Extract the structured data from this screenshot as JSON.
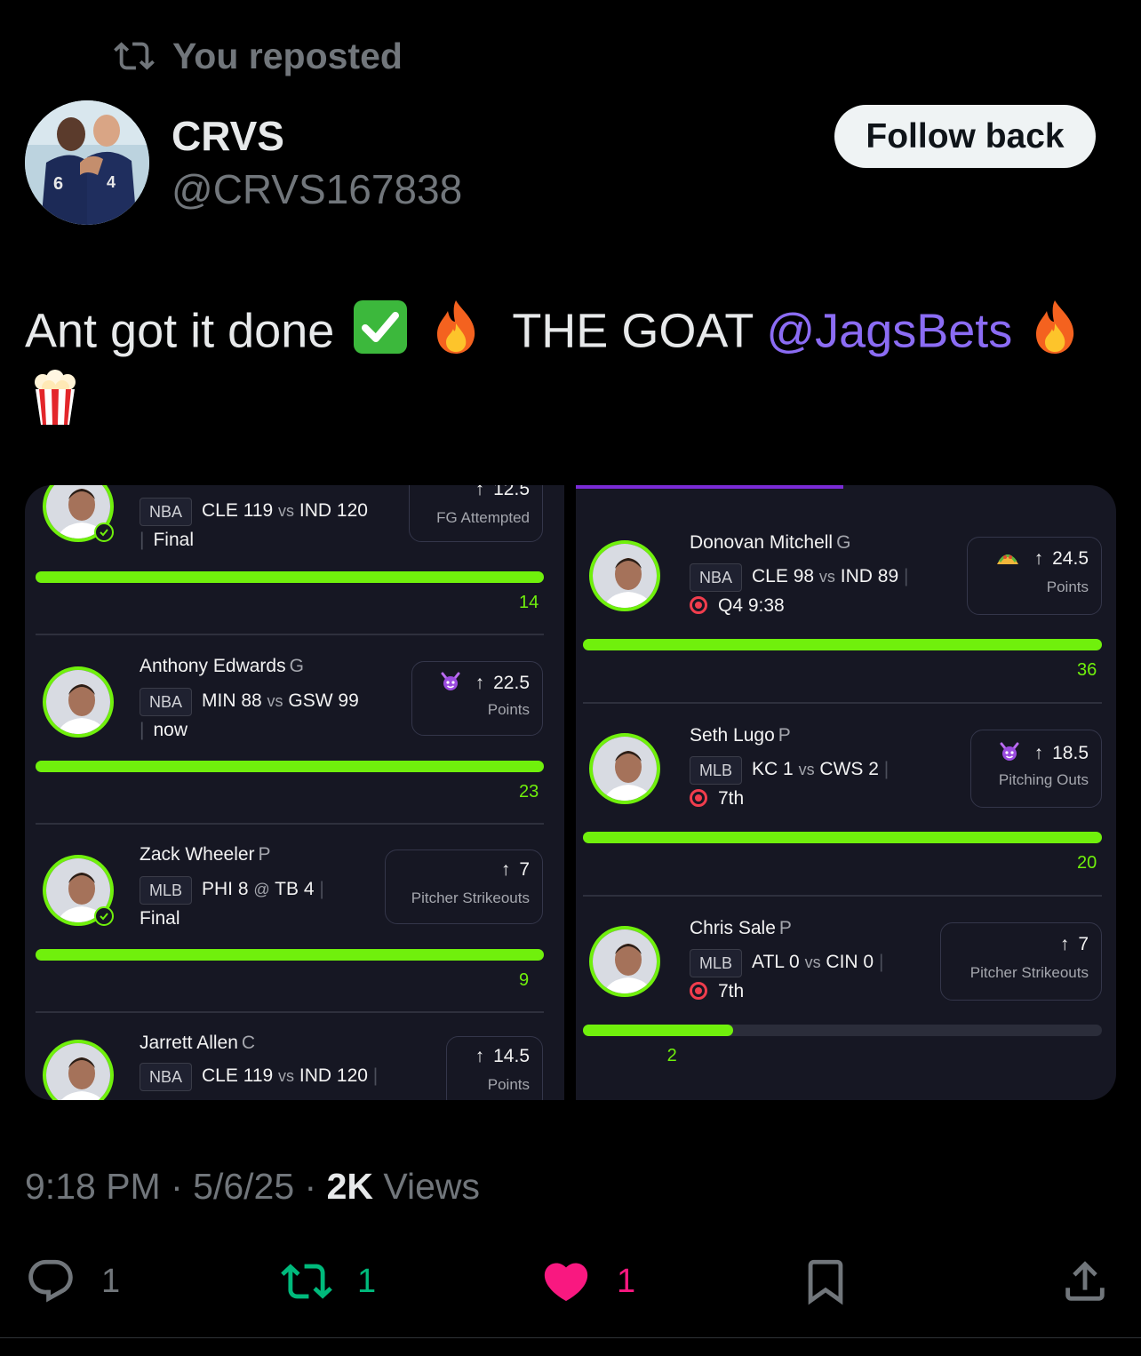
{
  "repost": {
    "label": "You reposted"
  },
  "author": {
    "name": "CRVS",
    "handle": "@CRVS167838",
    "follow_label": "Follow back"
  },
  "tweet": {
    "text_before": "Ant got it done",
    "text_mid": "THE GOAT",
    "mention": "@JagsBets"
  },
  "colors": {
    "accent_green": "#70f00c",
    "mention": "#8b6cf4",
    "like": "#f91880",
    "repost": "#00ba7c",
    "live": "#f13d4d"
  },
  "left_cards": [
    {
      "player": "",
      "position": "",
      "league": "NBA",
      "team1": "CLE",
      "score1": "119",
      "team2": "IND",
      "score2": "120",
      "status": "Final",
      "line": "12.5",
      "stat": "FG Attempted",
      "value": "14",
      "progress": 1.0,
      "icon": ""
    },
    {
      "player": "Anthony Edwards",
      "position": "G",
      "league": "NBA",
      "team1": "MIN",
      "score1": "88",
      "team2": "GSW",
      "score2": "99",
      "status": "now",
      "line": "22.5",
      "stat": "Points",
      "value": "23",
      "progress": 1.0,
      "icon": "devil-face-icon"
    },
    {
      "player": "Zack Wheeler",
      "position": "P",
      "league": "MLB",
      "team1": "PHI",
      "score1": "8",
      "at": "@",
      "team2": "TB",
      "score2": "4",
      "status": "Final",
      "line": "7",
      "stat": "Pitcher Strikeouts",
      "value": "9",
      "progress": 1.0,
      "icon": ""
    },
    {
      "player": "Jarrett Allen",
      "position": "C",
      "league": "NBA",
      "team1": "CLE",
      "score1": "119",
      "team2": "IND",
      "score2": "120",
      "status": "",
      "line": "14.5",
      "stat": "Points",
      "value": "",
      "progress": 1.0,
      "icon": ""
    }
  ],
  "right_cards": [
    {
      "player": "Donovan Mitchell",
      "position": "G",
      "league": "NBA",
      "team1": "CLE",
      "score1": "98",
      "team2": "IND",
      "score2": "89",
      "status": "Q4 9:38",
      "line": "24.5",
      "stat": "Points",
      "value": "36",
      "progress": 1.0,
      "icon": "taco-icon"
    },
    {
      "player": "Seth Lugo",
      "position": "P",
      "league": "MLB",
      "team1": "KC",
      "score1": "1",
      "team2": "CWS",
      "score2": "2",
      "status": "7th",
      "line": "18.5",
      "stat": "Pitching Outs",
      "value": "20",
      "progress": 1.0,
      "icon": "devil-face-icon"
    },
    {
      "player": "Chris Sale",
      "position": "P",
      "league": "MLB",
      "team1": "ATL",
      "score1": "0",
      "team2": "CIN",
      "score2": "0",
      "status": "7th",
      "line": "7",
      "stat": "Pitcher Strikeouts",
      "value": "2",
      "progress": 0.29,
      "icon": ""
    }
  ],
  "vs_label": "vs",
  "meta": {
    "time": "9:18 PM",
    "date": "5/6/25",
    "views_count": "2K",
    "views_label": "Views"
  },
  "actions": {
    "replies": "1",
    "reposts": "1",
    "likes": "1"
  }
}
